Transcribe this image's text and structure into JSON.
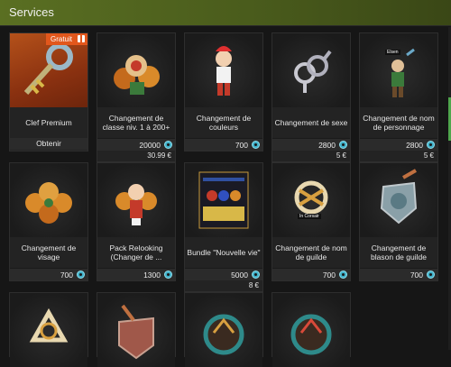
{
  "header": {
    "title": "Services"
  },
  "icons": {
    "currency": "ogrine-icon"
  },
  "colors": {
    "header": "#5a6f22",
    "badge": "#e2571c",
    "ogrine": "#3fb0c8",
    "scroll": "#4fa64c"
  },
  "items": [
    {
      "name": "Clef Premium",
      "badge": "Gratuit",
      "action": "Obtenir"
    },
    {
      "name": "Changement de classe niv. 1 à 200+",
      "price": "20000",
      "euro": "30.99 €"
    },
    {
      "name": "Changement de couleurs",
      "price": "700"
    },
    {
      "name": "Changement de sexe",
      "price": "2800",
      "euro": "5 €"
    },
    {
      "name": "Changement de nom de personnage",
      "price": "2800",
      "euro": "5 €",
      "thumb_label": "Elsen"
    },
    {
      "name": "Changement de visage",
      "price": "700"
    },
    {
      "name": "Pack Relooking (Changer de ...",
      "price": "1300"
    },
    {
      "name": "Bundle \"Nouvelle vie\"",
      "price": "5000",
      "euro": "8 €"
    },
    {
      "name": "Changement de nom de guilde",
      "price": "700",
      "thumb_label": "In Corsair"
    },
    {
      "name": "Changement de blason de guilde",
      "price": "700"
    }
  ]
}
